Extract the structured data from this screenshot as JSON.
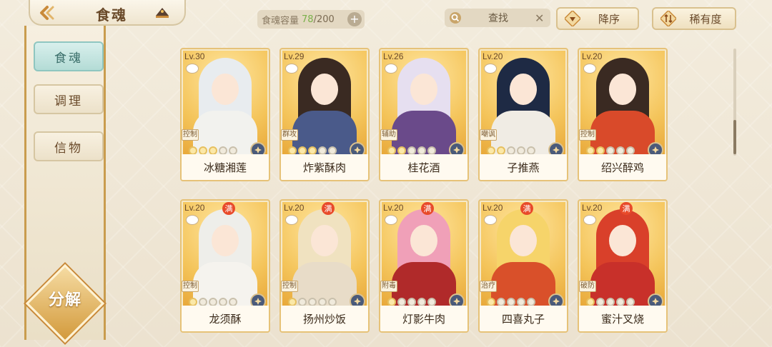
{
  "header": {
    "title": "食魂",
    "capacity_label": "食魂容量",
    "capacity_current": "78",
    "capacity_total": "/200",
    "capacity_add": "+",
    "search_label": "查找",
    "search_clear": "✕",
    "sort_order_label": "降序",
    "sort_rarity_label": "稀有度"
  },
  "sidebar": {
    "items": [
      {
        "label": "食魂",
        "active": true
      },
      {
        "label": "调理",
        "active": false
      },
      {
        "label": "信物",
        "active": false
      }
    ],
    "decompose_label": "分解"
  },
  "cards": [
    {
      "level": "Lv.30",
      "name": "冰糖湘莲",
      "role": "控制",
      "full": false,
      "stars_filled": 3,
      "hair": "#e8ecef",
      "body": "#f2f2ee"
    },
    {
      "level": "Lv.29",
      "name": "炸紫酥肉",
      "role": "群攻",
      "full": false,
      "stars_filled": 3,
      "hair": "#3a2a22",
      "body": "#4a5a8a"
    },
    {
      "level": "Lv.26",
      "name": "桂花酒",
      "role": "辅助",
      "full": false,
      "stars_filled": 2,
      "hair": "#e6dff0",
      "body": "#6a4a8a"
    },
    {
      "level": "Lv.20",
      "name": "子推燕",
      "role": "嘲讽",
      "full": false,
      "stars_filled": 2,
      "hair": "#1e2a44",
      "body": "#f0ece4"
    },
    {
      "level": "Lv.20",
      "name": "绍兴醉鸡",
      "role": "控制",
      "full": false,
      "stars_filled": 2,
      "hair": "#3a2a22",
      "body": "#d94a2a"
    },
    {
      "level": "Lv.20",
      "name": "龙须酥",
      "role": "控制",
      "full": true,
      "stars_filled": 1,
      "hair": "#eeeeea",
      "body": "#f5f3ee"
    },
    {
      "level": "Lv.20",
      "name": "扬州炒饭",
      "role": "控制",
      "full": true,
      "stars_filled": 1,
      "hair": "#f0e2c0",
      "body": "#e8dcc8"
    },
    {
      "level": "Lv.20",
      "name": "灯影牛肉",
      "role": "附毒",
      "full": true,
      "stars_filled": 1,
      "hair": "#f0a0b8",
      "body": "#b02a2a"
    },
    {
      "level": "Lv.20",
      "name": "四喜丸子",
      "role": "治疗",
      "full": true,
      "stars_filled": 1,
      "hair": "#f6d46a",
      "body": "#d9502a"
    },
    {
      "level": "Lv.20",
      "name": "蜜汁叉烧",
      "role": "破防",
      "full": true,
      "stars_filled": 1,
      "hair": "#d9402a",
      "body": "#c8302a"
    }
  ],
  "full_tag_label": "满",
  "colors": {
    "accent_gold": "#c98a3a",
    "active_tab": "#b4dcd6",
    "capacity_current": "#7ab04a"
  }
}
